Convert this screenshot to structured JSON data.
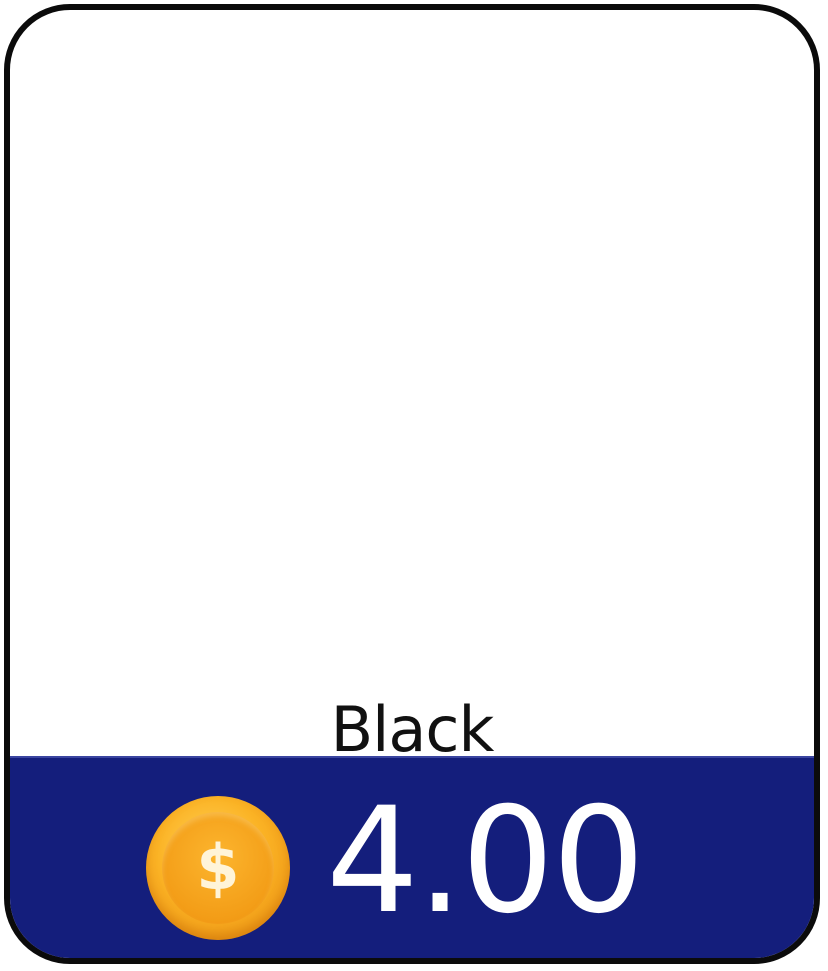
{
  "item": {
    "name": "Black"
  },
  "price": {
    "currency_symbol": "$",
    "value": "4.00"
  },
  "colors": {
    "card_border": "#0b0b0b",
    "price_bar": "#141e7c",
    "coin": "#fbb325",
    "price_text": "#ffffff"
  }
}
